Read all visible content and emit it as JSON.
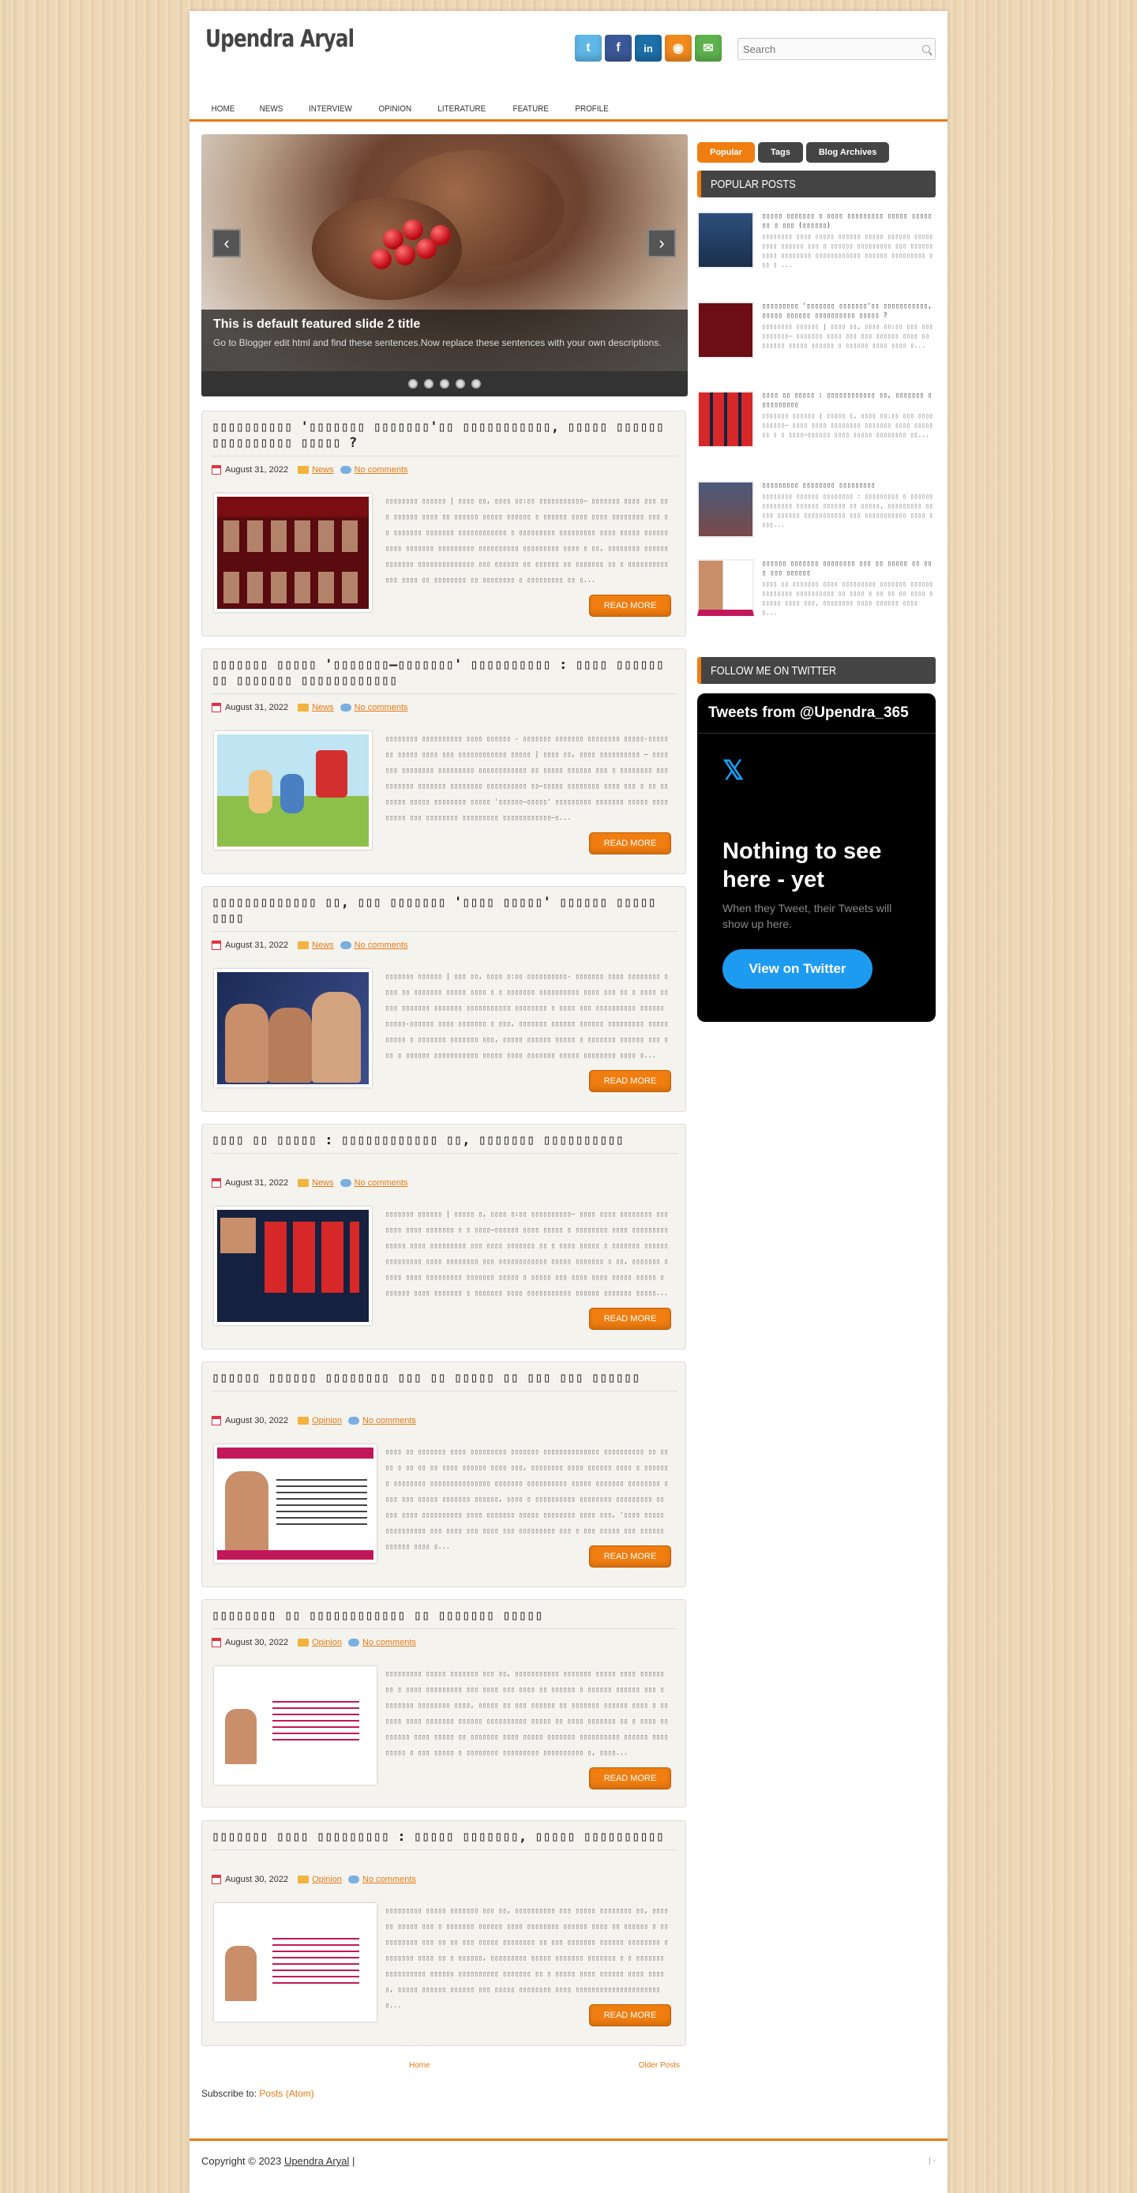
{
  "site": {
    "title": "Upendra Aryal"
  },
  "search": {
    "placeholder": "Search"
  },
  "social": [
    "twitter-icon",
    "facebook-icon",
    "linkedin-icon",
    "rss-icon",
    "email-icon"
  ],
  "nav": [
    "HOME",
    "NEWS",
    "INTERVIEW",
    "OPINION",
    "LITERATURE",
    "FEATURE",
    "PROFILE"
  ],
  "slider": {
    "title": "This is default featured slide 2 title",
    "text": "Go to Blogger edit html and find these sentences.Now replace these sentences with your own descriptions.",
    "prev": "‹",
    "next": "›"
  },
  "posts": [
    {
      "title": "▯▯▯▯▯▯▯▯▯▯ '▯▯▯▯▯▯▯ ▯▯▯▯▯▯▯'▯▯ ▯▯▯▯▯▯▯▯▯▯▯, ▯▯▯▯▯ ▯▯▯▯▯▯ ▯▯▯▯▯▯▯▯▯▯ ▯▯▯▯▯ ?",
      "date": "August 31, 2022",
      "label": "News",
      "comments": "No comments",
      "snippet": " ▯▯▯▯▯▯▯▯ ▯▯▯▯▯▯ | ▯▯▯▯ ▯▯, ▯▯▯▯ ▯▯:▯▯ ▯▯▯▯▯▯▯▯▯▯▯– ▯▯▯▯▯▯▯ ▯▯▯▯ ▯▯▯ ▯▯▯ ▯▯▯▯▯▯ ▯▯▯▯ ▯▯ ▯▯▯▯▯▯ ▯▯▯▯▯ ▯▯▯▯▯▯ ▯ ▯▯▯▯▯▯ ▯▯▯▯ ▯▯▯▯ ▯▯▯▯▯▯▯▯ ▯▯▯ ▯▯ ▯▯▯▯▯▯▯ ▯▯▯▯▯▯▯ ▯▯▯▯▯▯▯▯▯▯▯▯ ▯ ▯▯▯▯▯▯▯▯▯ ▯▯▯▯▯▯▯▯▯ ▯▯▯▯ ▯▯▯▯▯ ▯▯▯▯▯▯▯▯▯▯ ▯▯▯▯▯▯▯ ▯▯▯▯▯▯▯▯▯ ▯▯▯▯▯▯▯▯▯▯ ▯▯▯▯▯▯▯▯▯ ▯▯▯▯ ▯ ▯▯, ▯▯▯▯▯▯▯▯ ▯▯▯▯▯▯ ▯▯▯▯▯▯▯ ▯▯▯▯▯▯▯▯▯▯▯▯▯▯ ▯▯▯ ▯▯▯▯▯▯ ▯▯ ▯▯▯▯▯▯ ▯▯ ▯▯▯▯▯▯▯ ▯▯ ▯ ▯▯▯▯▯▯▯▯▯▯ ▯▯▯ ▯▯▯▯ ▯▯ ▯▯▯▯▯▯▯▯ ▯▯ ▯▯▯▯▯▯▯▯ ▯ ▯▯▯▯▯▯▯▯▯ ▯▯ ▯..."
    },
    {
      "title": "▯▯▯▯▯▯▯ ▯▯▯▯▯ '▯▯▯▯▯▯▯–▯▯▯▯▯▯▯' ▯▯▯▯▯▯▯▯▯▯ : ▯▯▯▯ ▯▯▯▯▯▯ ▯▯ ▯▯▯▯▯▯▯ ▯▯▯▯▯▯▯▯▯▯▯▯",
      "date": "August 31, 2022",
      "label": "News",
      "comments": "No comments",
      "snippet": " ▯▯▯▯▯▯▯▯ ▯▯▯▯▯▯▯▯▯▯ ▯▯▯▯ ▯▯▯▯▯▯ - ▯▯▯▯▯▯▯ ▯▯▯▯▯▯▯ ▯▯▯▯▯▯▯▯ ▯▯▯▯▯-▯▯▯▯▯ ▯▯ ▯▯▯▯▯ ▯▯▯▯ ▯▯▯ ▯▯▯▯▯▯▯▯▯▯▯▯ ▯▯▯▯▯ | ▯▯▯▯ ▯▯, ▯▯▯▯ ▯▯▯▯▯▯▯▯▯▯ – ▯▯▯▯▯▯▯ ▯▯▯▯▯▯▯▯ ▯▯▯▯▯▯▯▯▯ ▯▯▯▯▯▯▯▯▯▯▯▯ ▯▯ ▯▯▯▯▯ ▯▯▯▯▯▯ ▯▯▯ ▯ ▯▯▯▯▯▯▯▯ ▯▯▯▯▯▯▯▯▯▯ ▯▯▯▯▯▯▯ ▯▯▯▯▯▯▯▯ ▯▯▯▯▯▯▯▯▯▯ ▯▯–▯▯▯▯▯ ▯▯▯▯▯▯▯▯ ▯▯▯▯ ▯▯▯ ▯ ▯▯ ▯▯▯▯▯▯▯ ▯▯▯▯▯ ▯▯▯▯▯▯▯▯ ▯▯▯▯▯ '▯▯▯▯▯▯–▯▯▯▯▯' ▯▯▯▯▯▯▯▯▯ ▯▯▯▯▯▯▯ ▯▯▯▯▯ ▯▯▯▯ ▯▯▯▯▯ ▯▯▯ ▯▯▯▯▯▯▯▯ ▯▯▯▯▯▯▯▯▯ ▯▯▯▯▯▯▯▯▯▯▯▯–▯..."
    },
    {
      "title": "▯▯▯▯▯▯▯▯▯▯▯▯▯ ▯▯, ▯▯▯ ▯▯▯▯▯▯▯ '▯▯▯▯ ▯▯▯▯▯' ▯▯▯▯▯▯ ▯▯▯▯▯ ▯▯▯▯",
      "date": "August 31, 2022",
      "label": "News",
      "comments": "No comments",
      "snippet": "▯▯▯▯▯▯▯ ▯▯▯▯▯▯ | ▯▯▯ ▯▯, ▯▯▯▯ ▯:▯▯ ▯▯▯▯▯▯▯▯▯▯- ▯▯▯▯▯▯▯ ▯▯▯▯ ▯▯▯▯▯▯▯▯ ▯▯▯▯ ▯▯ ▯▯▯▯▯▯▯ ▯▯▯▯▯ ▯▯▯▯ ▯ ▯ ▯▯▯▯▯▯▯ ▯▯▯▯▯▯▯▯▯▯ ▯▯▯▯ ▯▯▯ ▯▯ ▯ ▯▯▯▯ ▯▯▯▯▯ ▯▯▯▯▯▯▯ ▯▯▯▯▯▯▯ ▯▯▯▯▯▯▯▯▯▯▯ ▯▯▯▯▯▯▯▯ ▯ ▯▯▯▯ ▯▯▯ ▯▯▯▯▯▯▯▯▯▯ ▯▯▯▯▯▯ ▯▯▯▯▯-▯▯▯▯▯▯ ▯▯▯▯ ▯▯▯▯▯▯▯ ▯ ▯▯▯, ▯▯▯▯▯▯▯ ▯▯▯▯▯▯ ▯▯▯▯▯▯ ▯▯▯▯▯▯▯▯▯ ▯▯▯▯▯▯▯▯▯▯ ▯ ▯▯▯▯▯▯▯ ▯▯▯▯▯▯▯ ▯▯▯, ▯▯▯▯▯ ▯▯▯▯▯▯ ▯▯▯▯▯ ▯ ▯▯▯▯▯▯▯ ▯▯▯▯▯▯ ▯▯▯ ▯▯▯ ▯ ▯▯▯▯▯▯ ▯▯▯▯▯▯▯▯▯▯▯ ▯▯▯▯▯ ▯▯▯▯ ▯▯▯▯▯▯▯ ▯▯▯▯▯ ▯▯▯▯▯▯▯▯ ▯▯▯▯ ▯..."
    },
    {
      "title": "▯▯▯▯ ▯▯ ▯▯▯▯▯ : ▯▯▯▯▯▯▯▯▯▯▯▯ ▯▯, ▯▯▯▯▯▯▯ ▯▯▯▯▯▯▯▯▯▯",
      "date": "August 31, 2022",
      "label": "News",
      "comments": "No comments",
      "snippet": "▯▯▯▯▯▯▯ ▯▯▯▯▯▯ | ▯▯▯▯▯ ▯, ▯▯▯▯ ▯:▯▯ ▯▯▯▯▯▯▯▯▯▯– ▯▯▯▯ ▯▯▯▯ ▯▯▯▯▯▯▯▯ ▯▯▯▯▯▯▯ ▯▯▯▯ ▯▯▯▯▯▯▯ ▯ ▯ ▯▯▯▯–▯▯▯▯▯▯ ▯▯▯▯ ▯▯▯▯▯ ▯ ▯▯▯▯▯▯▯▯ ▯▯▯▯ ▯▯▯▯▯▯▯▯▯ ▯▯▯▯▯ ▯▯▯▯ ▯▯▯▯▯▯▯▯▯ ▯▯▯ ▯▯▯▯ ▯▯▯▯▯▯▯ ▯▯ ▯ ▯▯▯▯ ▯▯▯▯▯ ▯ ▯▯▯▯▯▯▯ ▯▯▯▯▯▯ ▯▯▯▯▯▯▯▯▯ ▯▯▯▯ ▯▯▯▯▯▯▯▯ ▯▯▯ ▯▯▯▯▯▯▯▯▯▯▯▯ ▯▯▯▯▯ ▯▯▯▯▯▯▯ ▯ ▯▯, ▯▯▯▯▯▯▯ ▯▯▯▯▯ ▯▯▯▯ ▯▯▯▯▯▯▯▯▯ ▯▯▯▯▯▯▯ ▯▯▯▯▯ ▯ ▯▯▯▯▯ ▯▯▯ ▯▯▯▯ ▯▯▯▯ ▯▯▯▯▯ ▯▯▯▯▯ ▯ ▯▯▯▯▯▯ ▯▯▯▯ ▯▯▯▯▯▯▯ ▯ ▯▯▯▯▯▯▯ ▯▯▯▯ ▯▯▯▯▯▯▯▯▯▯▯ ▯▯▯▯▯▯ ▯▯▯▯▯▯▯ ▯▯▯▯▯..."
    },
    {
      "title": "▯▯▯▯▯▯ ▯▯▯▯▯▯ ▯▯▯▯▯▯▯▯ ▯▯▯ ▯▯ ▯▯▯▯▯ ▯▯ ▯▯▯ ▯▯▯ ▯▯▯▯▯▯",
      "date": "August 30, 2022",
      "label": "Opinion",
      "comments": "No comments",
      "snippet": "▯▯▯▯ ▯▯ ▯▯▯▯▯▯▯ ▯▯▯▯ ▯▯▯▯▯▯▯▯▯ ▯▯▯▯▯▯▯ ▯▯▯▯▯▯▯▯▯▯▯▯▯▯ ▯▯▯▯▯▯▯▯▯▯ ▯▯ ▯▯▯▯ ▯ ▯▯ ▯▯ ▯▯ ▯▯▯▯ ▯▯▯▯▯▯ ▯▯▯▯ ▯▯▯, ▯▯▯▯▯▯▯▯ ▯▯▯▯ ▯▯▯▯▯▯ ▯▯▯▯ ▯ ▯▯▯▯▯▯▯ ▯▯▯▯▯▯▯▯ ▯▯▯▯▯▯▯▯▯▯▯▯▯▯▯ ▯▯▯▯▯▯▯ ▯▯▯▯▯▯▯▯▯▯ ▯▯▯▯▯ ▯▯▯▯▯▯▯ ▯▯▯▯▯▯▯▯ ▯▯▯▯ ▯▯▯ ▯▯▯▯▯ ▯▯▯▯▯▯▯ ▯▯▯▯▯▯, ▯▯▯▯ ▯ ▯▯▯▯▯▯▯▯▯▯ ▯▯▯▯▯▯▯▯ ▯▯▯▯▯▯▯▯▯ ▯▯ ▯▯▯ ▯▯▯▯ ▯▯▯▯▯▯▯▯▯▯ ▯▯▯▯ ▯▯▯▯▯▯▯ ▯▯▯▯▯ ▯▯▯▯▯▯▯▯ ▯▯▯▯ ▯▯▯, '▯▯▯▯ ▯▯▯▯▯ ▯▯▯▯▯▯▯▯▯▯ ▯▯▯ ▯▯▯▯ ▯▯▯ ▯▯▯▯ ▯▯▯ ▯▯▯▯▯▯▯▯▯ ▯▯▯ ▯ ▯▯▯ ▯▯▯▯▯ ▯▯▯ ▯▯▯▯▯▯ ▯▯▯▯▯▯ ▯▯▯▯ ▯..."
    },
    {
      "title": "▯▯▯▯▯▯▯▯ ▯▯ ▯▯▯▯▯▯▯▯▯▯▯▯ ▯▯ ▯▯▯▯▯▯▯ ▯▯▯▯▯",
      "date": "August 30, 2022",
      "label": "Opinion",
      "comments": "No comments",
      "snippet": "▯▯▯▯▯▯▯▯▯ ▯▯▯▯▯ ▯▯▯▯▯▯▯  ▯▯▯ ▯▯, ▯▯▯▯▯▯▯▯▯▯▯ ▯▯▯▯▯▯▯ ▯▯▯▯▯ ▯▯▯▯ ▯▯▯▯▯▯ ▯▯ ▯ ▯▯▯▯ ▯▯▯▯▯▯▯▯▯ ▯▯▯ ▯▯▯▯ ▯▯▯ ▯▯▯▯ ▯▯ ▯▯▯▯▯▯ ▯ ▯▯▯▯▯▯ ▯▯▯▯▯▯ ▯▯▯ ▯ ▯▯▯▯▯▯▯ ▯▯▯▯▯▯▯▯ ▯▯▯▯, ▯▯▯▯▯ ▯▯ ▯▯▯ ▯▯▯▯▯▯ ▯▯ ▯▯▯▯▯▯▯ ▯▯▯▯▯▯ ▯▯▯▯ ▯ ▯▯▯▯▯▯ ▯▯▯▯ ▯▯▯▯▯▯▯ ▯▯▯▯▯▯ ▯▯▯▯▯▯▯▯▯▯ ▯▯▯▯▯ ▯▯ ▯▯▯▯ ▯▯▯▯▯▯▯ ▯▯ ▯ ▯▯▯▯ ▯▯▯▯▯▯▯▯ ▯▯▯▯ ▯▯▯▯▯ ▯▯ ▯▯▯▯▯▯▯ ▯▯▯▯ ▯▯▯▯▯ ▯▯▯▯▯▯▯ ▯▯▯▯▯▯▯▯▯▯ ▯▯▯▯▯▯ ▯▯▯▯ ▯▯▯▯▯ ▯ ▯▯▯ ▯▯▯▯▯ ▯ ▯▯▯▯▯▯▯▯ ▯▯▯▯▯▯▯▯▯ ▯▯▯▯▯▯▯▯▯▯ ▯, ▯▯▯▯..."
    },
    {
      "title": "▯▯▯▯▯▯▯ ▯▯▯▯ ▯▯▯▯▯▯▯▯▯ : ▯▯▯▯▯ ▯▯▯▯▯▯▯, ▯▯▯▯▯ ▯▯▯▯▯▯▯▯▯▯",
      "date": "August 30, 2022",
      "label": "Opinion",
      "comments": "No comments",
      "snippet": "▯▯▯▯▯▯▯▯▯ ▯▯▯▯▯ ▯▯▯▯▯▯▯  ▯▯▯ ▯▯, ▯▯▯▯▯▯▯▯▯▯ ▯▯▯ ▯▯▯▯▯ ▯▯▯▯▯▯▯▯ ▯▯, ▯▯▯▯▯▯ ▯▯▯▯▯ ▯▯▯ ▯ ▯▯▯▯▯▯▯ ▯▯▯▯▯▯ ▯▯▯▯ ▯▯▯▯▯▯▯▯ ▯▯▯▯▯▯ ▯▯▯▯ ▯▯ ▯▯▯▯▯▯ ▯ ▯▯▯▯▯▯▯▯▯▯ ▯▯▯ ▯▯ ▯▯ ▯▯▯ ▯▯▯▯▯ ▯▯▯▯▯▯▯▯ ▯▯ ▯▯▯ ▯▯▯▯▯▯▯ ▯▯▯▯▯▯ ▯▯▯▯▯▯▯▯ ▯▯▯▯▯▯▯▯ ▯▯▯▯ ▯▯ ▯ ▯▯▯▯▯▯, ▯▯▯▯▯▯▯▯▯ ▯▯▯▯▯ ▯▯▯▯▯▯▯ ▯▯▯▯▯▯▯ ▯ ▯ ▯▯▯▯▯▯▯ ▯▯▯▯▯▯▯▯▯▯ ▯▯▯▯▯▯ ▯▯▯▯▯▯▯▯▯▯ ▯▯▯▯▯▯▯ ▯▯ ▯ ▯▯▯▯▯ ▯▯▯▯ ▯▯▯▯▯▯ ▯▯▯▯ ▯▯▯▯▯, ▯▯▯▯▯ ▯▯▯▯▯▯ ▯▯▯▯▯▯ ▯▯▯ ▯▯▯▯▯ ▯▯▯▯▯▯▯▯ ▯▯▯▯ ▯▯▯▯▯▯▯▯▯▯▯▯▯▯▯▯▯▯▯▯▯▯..."
    }
  ],
  "read_more": "READ MORE",
  "pager": {
    "home": "Home",
    "older": "Older Posts"
  },
  "subscribe": {
    "label": "Subscribe to:",
    "link": "Posts (Atom)"
  },
  "sidebar": {
    "tabs": [
      "Popular",
      "Tags",
      "Blog Archives"
    ],
    "popular_heading": "POPULAR POSTS",
    "twitter_heading": "FOLLOW ME ON TWITTER",
    "popular": [
      {
        "title": "▯▯▯▯▯ ▯▯▯▯▯▯▯ ▯ ▯▯▯▯ ▯▯▯▯▯▯▯▯▯ ▯▯▯▯▯ ▯▯▯▯▯▯▯ ▯ ▯▯▯ (▯▯▯▯▯▯)",
        "snippet": " ▯▯▯▯▯▯▯▯ ▯▯▯▯ ▯▯▯▯▯ ▯▯▯▯▯▯ ▯▯▯▯▯ ▯▯▯▯▯▯ ▯▯▯▯▯▯▯▯▯ ▯▯▯▯▯▯ ▯▯▯ ▯ ▯▯▯▯▯▯ ▯▯▯▯▯▯▯▯▯ ▯▯▯ ▯▯▯▯▯▯▯▯▯▯ ▯▯▯▯▯▯▯▯ ▯▯▯▯▯▯▯▯▯▯▯▯ ▯▯▯▯▯▯ ▯▯▯▯▯▯▯▯▯ ▯▯▯ ▯ ..."
      },
      {
        "title": "▯▯▯▯▯▯▯▯▯ '▯▯▯▯▯▯▯ ▯▯▯▯▯▯▯'▯▯ ▯▯▯▯▯▯▯▯▯▯▯, ▯▯▯▯▯ ▯▯▯▯▯▯ ▯▯▯▯▯▯▯▯▯▯ ▯▯▯▯▯ ?",
        "snippet": " ▯▯▯▯▯▯▯▯ ▯▯▯▯▯▯ |  ▯▯▯▯ ▯▯, ▯▯▯▯ ▯▯:▯▯ ▯▯▯ ▯▯▯▯▯▯▯▯▯▯– ▯▯▯▯▯▯▯ ▯▯▯▯ ▯▯▯ ▯▯▯ ▯▯▯▯▯▯ ▯▯▯▯ ▯▯ ▯▯▯▯▯▯ ▯▯▯▯▯ ▯▯▯▯▯▯ ▯ ▯▯▯▯▯▯ ▯▯▯▯ ▯▯▯▯ ▯..."
      },
      {
        "title": "▯▯▯▯ ▯▯ ▯▯▯▯▯ : ▯▯▯▯▯▯▯▯▯▯▯▯ ▯▯, ▯▯▯▯▯▯▯ ▯▯▯▯▯▯▯▯▯▯",
        "snippet": "▯▯▯▯▯▯▯ ▯▯▯▯▯▯ |   ▯▯▯▯▯ ▯, ▯▯▯▯ ▯▯:▯▯ ▯▯▯ ▯▯▯▯▯▯▯▯▯▯–  ▯▯▯▯ ▯▯▯▯ ▯▯▯▯▯▯▯▯ ▯▯▯▯▯▯▯ ▯▯▯▯ ▯▯▯▯▯▯▯ ▯ ▯ ▯▯▯▯–▯▯▯▯▯▯ ▯▯▯▯ ▯▯▯▯▯ ▯▯▯▯▯▯▯▯ ▯▯..."
      },
      {
        "title": "▯▯▯▯▯▯▯▯▯ ▯▯▯▯▯▯▯▯ ▯▯▯▯▯▯▯▯▯",
        "snippet": " ▯▯▯▯▯▯▯▯ ▯▯▯▯▯▯ ▯▯▯▯▯▯▯▯ :   ▯▯▯▯▯▯▯▯▯ ▯ ▯▯▯▯▯▯▯▯▯▯▯▯▯▯ ▯▯▯▯▯▯ ▯▯▯▯▯▯ ▯▯ ▯▯▯▯▯, ▯▯▯▯▯▯▯▯▯ ▯▯▯▯▯ ▯▯▯▯▯▯ ▯▯▯▯▯▯▯▯▯▯▯ ▯▯▯ ▯▯▯▯▯▯▯▯▯▯▯ ▯▯▯▯ ▯▯▯▯..."
      },
      {
        "title": "▯▯▯▯▯▯ ▯▯▯▯▯▯▯ ▯▯▯▯▯▯▯▯ ▯▯▯ ▯▯ ▯▯▯▯▯ ▯▯ ▯▯▯ ▯▯▯ ▯▯▯▯▯▯",
        "snippet": "▯▯▯▯ ▯▯ ▯▯▯▯▯▯▯ ▯▯▯▯ ▯▯▯▯▯▯▯▯▯ ▯▯▯▯▯▯▯ ▯▯▯▯▯▯▯▯▯▯▯▯▯▯ ▯▯▯▯▯▯▯▯▯▯ ▯▯ ▯▯▯▯ ▯ ▯▯ ▯▯ ▯▯ ▯▯▯▯ ▯▯▯▯▯▯ ▯▯▯▯ ▯▯▯, ▯▯▯▯▯▯▯▯ ▯▯▯▯ ▯▯▯▯▯▯ ▯▯▯▯ ▯..."
      }
    ]
  },
  "twitter": {
    "header": "Tweets from @Upendra_365",
    "logo": "𝕏",
    "empty_title": "Nothing to see here - yet",
    "empty_text": "When they Tweet, their Tweets will show up here.",
    "button": "View on Twitter"
  },
  "footer": {
    "copyright": "Copyright © 2023",
    "owner": "Upendra Aryal",
    "separator": "|",
    "right": "|  -"
  },
  "colors": {
    "accent": "#f07d10",
    "dark": "#444444",
    "twitter_blue": "#1d9bf0"
  }
}
